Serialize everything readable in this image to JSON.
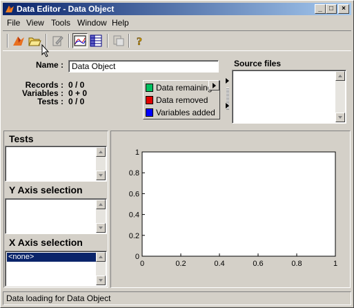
{
  "window": {
    "title": "Data Editor - Data Object",
    "controls": {
      "minimize": "_",
      "maximize": "□",
      "close": "×"
    }
  },
  "menu": [
    "File",
    "View",
    "Tools",
    "Window",
    "Help"
  ],
  "toolbar": {
    "icons": [
      "matlab-logo-icon",
      "open-folder-icon",
      "edit-icon",
      "plot-view-icon",
      "table-view-icon",
      "copy-icon",
      "help-icon"
    ]
  },
  "info": {
    "name_label": "Name :",
    "name_value": "Data Object",
    "records_label": "Records :",
    "records_value": "0 / 0",
    "variables_label": "Variables :",
    "variables_value": "0 + 0",
    "tests_label": "Tests :",
    "tests_value": "0 / 0"
  },
  "legend": [
    {
      "label": "Data remaining",
      "color": "#00c060"
    },
    {
      "label": "Data removed",
      "color": "#e00000"
    },
    {
      "label": "Variables added",
      "color": "#0000ff"
    }
  ],
  "source_files": {
    "title": "Source files"
  },
  "tests_panel": {
    "title": "Tests"
  },
  "y_axis_panel": {
    "title": "Y Axis selection"
  },
  "x_axis_panel": {
    "title": "X Axis selection",
    "items": [
      "<none>"
    ]
  },
  "chart_data": {
    "type": "line",
    "series": [],
    "xlim": [
      0,
      1
    ],
    "ylim": [
      0,
      1
    ],
    "xticks": [
      "0",
      "0.2",
      "0.4",
      "0.6",
      "0.8",
      "1"
    ],
    "yticks": [
      "0",
      "0.2",
      "0.4",
      "0.6",
      "0.8",
      "1"
    ],
    "grid": false
  },
  "status": {
    "text": "Data loading for Data Object"
  }
}
